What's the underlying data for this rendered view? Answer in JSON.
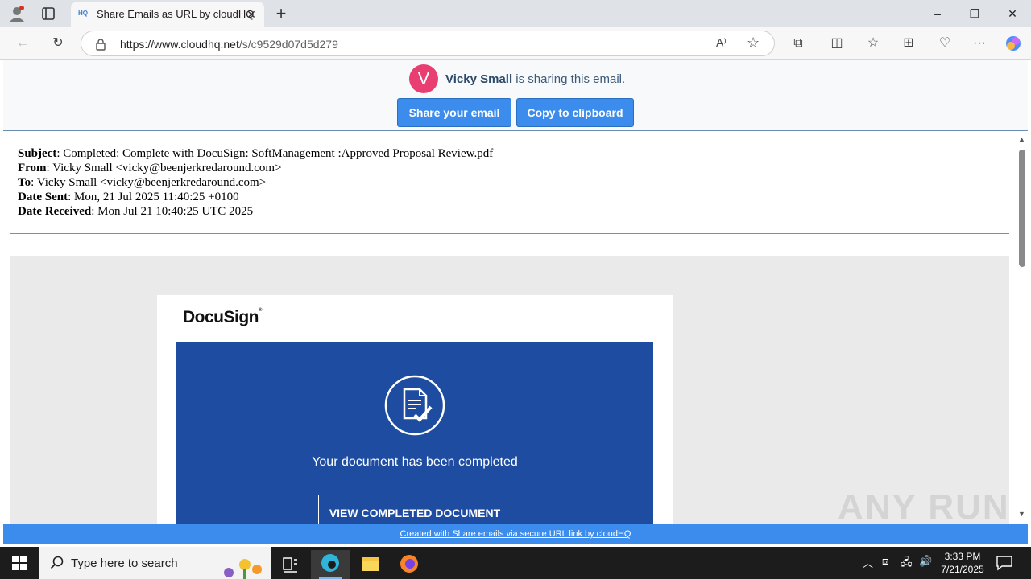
{
  "browser": {
    "tab_title": "Share Emails as URL by cloudHQ",
    "favicon_text": "HQ",
    "url_host": "https://www.cloudhq.net",
    "url_path": "/s/c9529d07d5d279"
  },
  "share_header": {
    "avatar_letter": "V",
    "sharer_name": "Vicky Small",
    "sharing_suffix": " is sharing this email.",
    "share_button": "Share your email",
    "copy_button": "Copy to clipboard"
  },
  "email": {
    "subject_label": "Subject",
    "subject": ": Completed: Complete with DocuSign: SoftManagement :Approved Proposal Review.pdf",
    "from_label": "From",
    "from": ": Vicky Small <vicky@beenjerkredaround.com>",
    "to_label": "To",
    "to": ": Vicky Small <vicky@beenjerkredaround.com>",
    "date_sent_label": "Date Sent",
    "date_sent": ": Mon, 21 Jul 2025 11:40:25 +0100",
    "date_received_label": "Date Received",
    "date_received": ": Mon Jul 21 10:40:25 UTC 2025"
  },
  "docusign": {
    "logo": "DocuSign",
    "completed_text": "Your document has been completed",
    "view_button": "VIEW COMPLETED DOCUMENT"
  },
  "footer": {
    "link_text": "Created with Share emails via secure URL link by cloudHQ"
  },
  "watermark": "ANY RUN",
  "taskbar": {
    "search_placeholder": "Type here to search",
    "time": "3:33 PM",
    "date": "7/21/2025"
  },
  "colors": {
    "accent_button": "#3b8ced",
    "docusign_blue": "#1e4ca1",
    "avatar": "#e83e72"
  }
}
